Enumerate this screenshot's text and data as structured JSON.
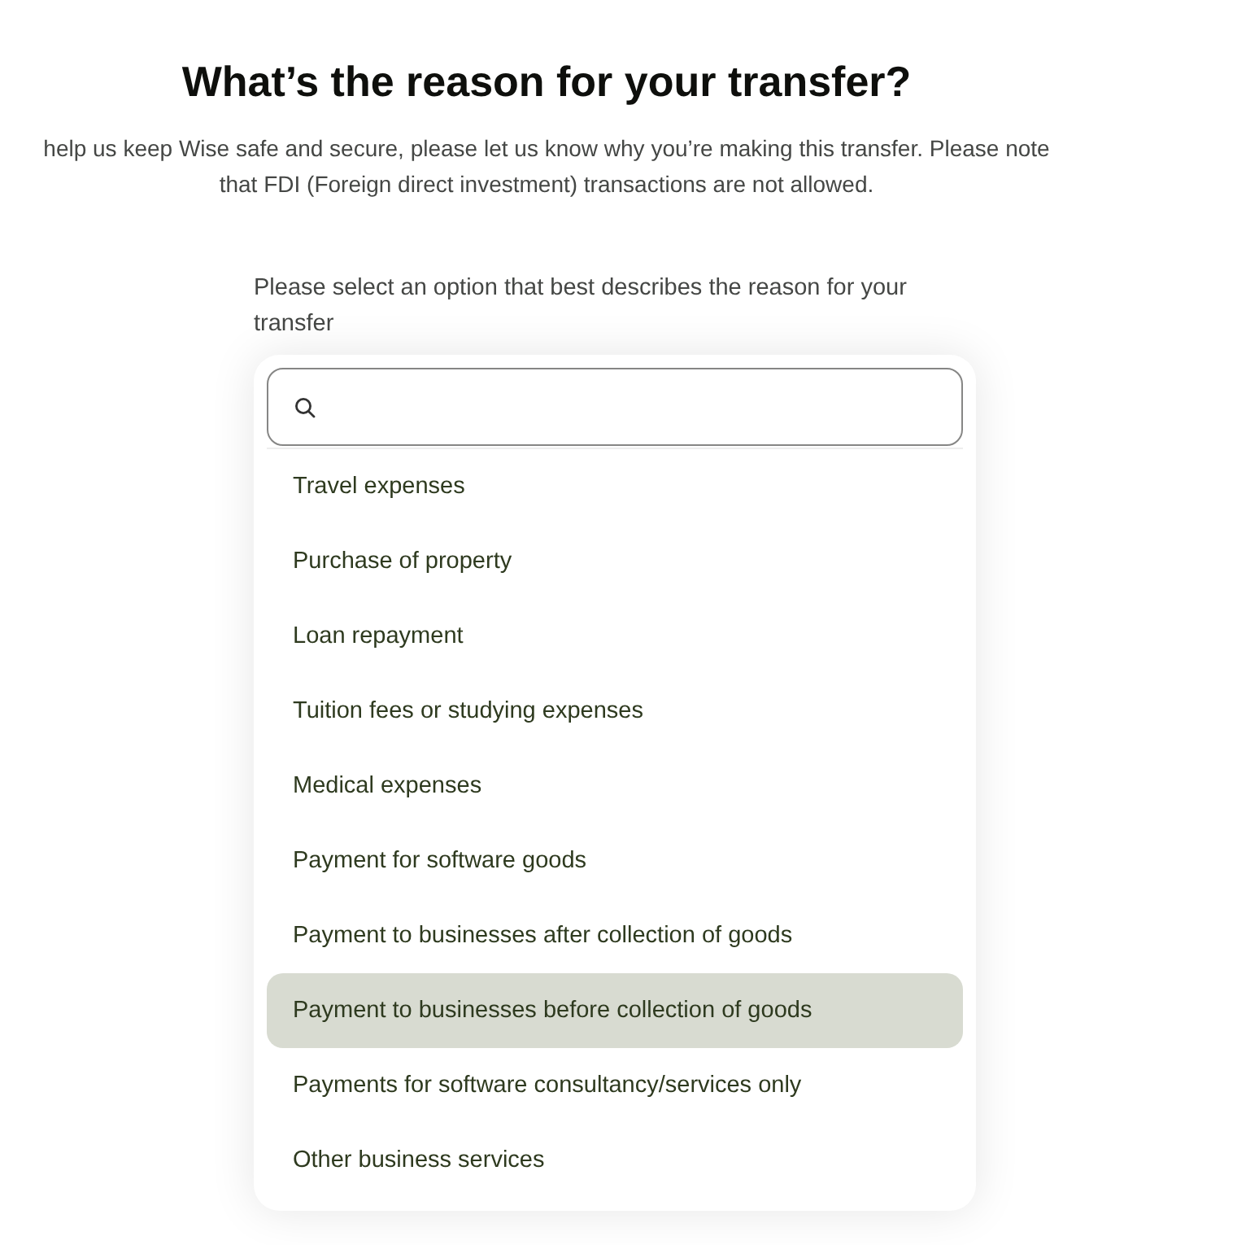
{
  "title": "What’s the reason for your transfer?",
  "intro": "help us keep Wise safe and secure, please let us know why you’re making this transfer. Please note that FDI (Foreign direct investment) transactions are not allowed.",
  "prompt": "Please select an option that best describes the reason for your transfer",
  "options": [
    {
      "label": "Travel expenses",
      "selected": false
    },
    {
      "label": "Purchase of property",
      "selected": false
    },
    {
      "label": "Loan repayment",
      "selected": false
    },
    {
      "label": "Tuition fees or studying expenses",
      "selected": false
    },
    {
      "label": "Medical expenses",
      "selected": false
    },
    {
      "label": "Payment for software goods",
      "selected": false
    },
    {
      "label": "Payment to businesses after collection of goods",
      "selected": false
    },
    {
      "label": "Payment to businesses before collection of goods",
      "selected": true
    },
    {
      "label": "Payments for software consultancy/services only",
      "selected": false
    },
    {
      "label": "Other business services",
      "selected": false
    }
  ]
}
